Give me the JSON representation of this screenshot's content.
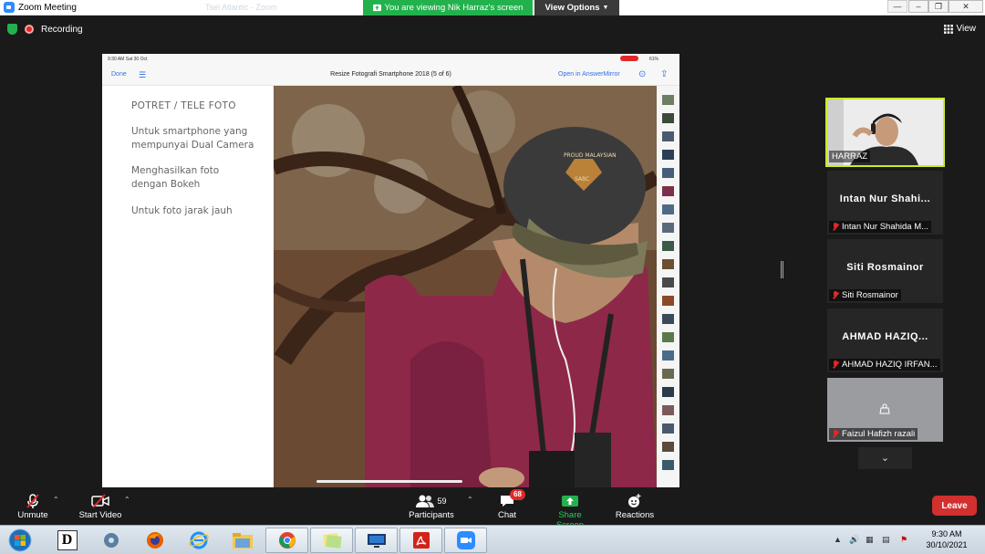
{
  "window": {
    "title": "Zoom Meeting",
    "ghost_tab_1": "Tsel Atlantic - Zoom",
    "ghost_tab_2": "Zoom"
  },
  "banner": {
    "text": "You are viewing Nik Harraz's screen",
    "view_options": "View Options"
  },
  "topbar": {
    "recording": "Recording",
    "view": "View"
  },
  "shared": {
    "status_time": "9:30 AM  Sat 30 Oct",
    "battery": "61%",
    "done": "Done",
    "doc_title": "Resize Fotografi Smartphone 2018 (5 of 6)",
    "open_in": "Open in AnswerMirror",
    "slide": {
      "heading": "POTRET / TELE FOTO",
      "line1a": "Untuk smartphone yang",
      "line1b": "mempunyai Dual Camera",
      "line2a": "Menghasilkan foto",
      "line2b": "dengan Bokeh",
      "line3": "Untuk foto jarak jauh"
    },
    "cap_text_1": "PROUD MALAYSIAN",
    "cap_text_2": "SABC"
  },
  "participants": [
    {
      "big": "",
      "small": "HARRAZ",
      "video": true
    },
    {
      "big": "Intan Nur Shahi...",
      "small": "Intan Nur Shahida M...",
      "muted": true
    },
    {
      "big": "Siti Rosmainor",
      "small": "Siti Rosmainor",
      "muted": true
    },
    {
      "big": "AHMAD  HAZIQ...",
      "small": "AHMAD HAZIQ IRFAN...",
      "muted": true
    },
    {
      "big": "",
      "small": "Faizul Hafizh razali",
      "muted": true
    }
  ],
  "controls": {
    "unmute": "Unmute",
    "start_video": "Start Video",
    "participants": "Participants",
    "participants_count": "59",
    "chat": "Chat",
    "chat_badge": "68",
    "share_screen": "Share Screen",
    "reactions": "Reactions",
    "leave": "Leave"
  },
  "taskbar": {
    "time": "9:30 AM",
    "date": "30/10/2021",
    "dl_icon_text": "D"
  },
  "colors": {
    "zoom_green": "#23b14d",
    "leave_red": "#d1302f",
    "speaker_border": "#cfe82a",
    "zoom_blue": "#2d8cff"
  }
}
